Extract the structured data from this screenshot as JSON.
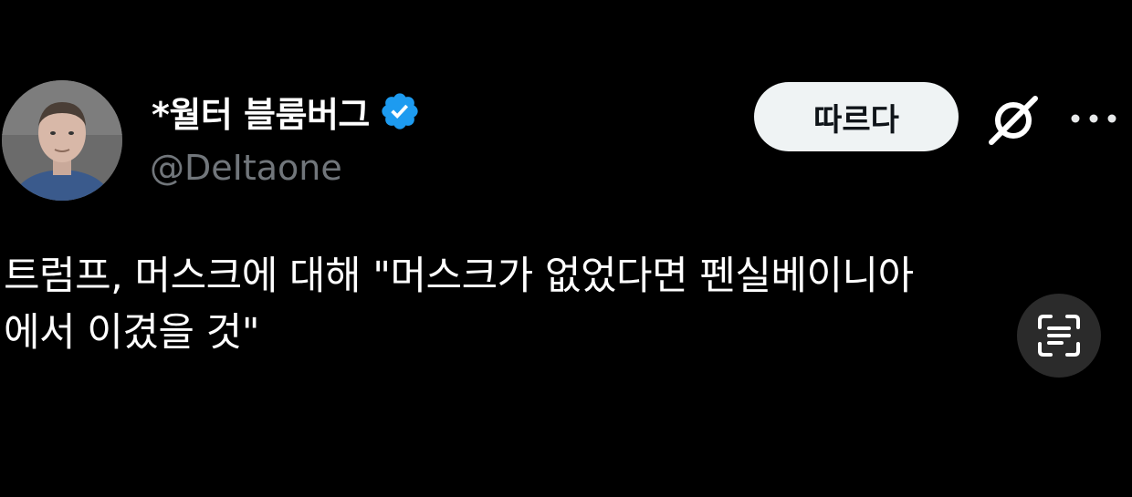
{
  "tweet": {
    "author": {
      "display_name": "*월터 블룸버그",
      "handle": "@DeItaone",
      "verified": true
    },
    "follow_label": "따르다",
    "text": "트럼프, 머스크에 대해 \"머스크가 없었다면 펜실베이니아\n에서 이겼을 것\""
  },
  "icons": {
    "avatar": "user-avatar",
    "verified": "verified-badge-icon",
    "grok": "grok-icon",
    "more": "more-options-icon",
    "scan": "text-scan-icon"
  },
  "colors": {
    "background": "#000000",
    "name": "#ffffff",
    "handle": "#71767b",
    "verified_blue": "#1d9bf0",
    "follow_bg": "#eff3f4",
    "follow_text": "#0f1419",
    "scan_bg": "#2b2b2b"
  }
}
